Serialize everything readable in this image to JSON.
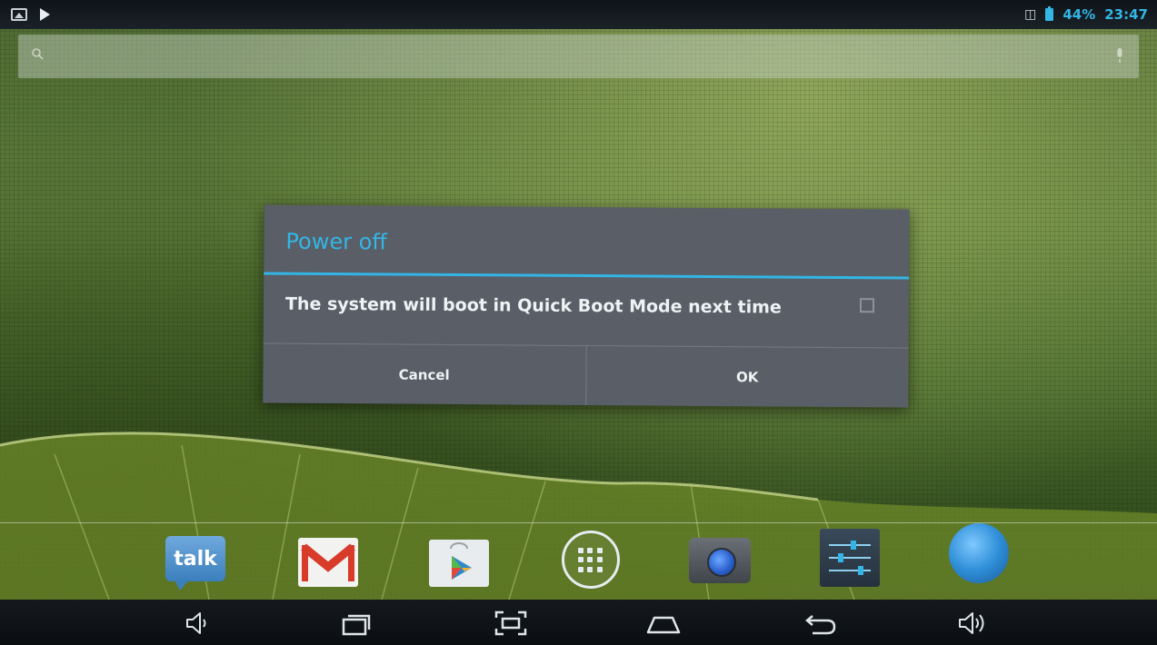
{
  "status_bar": {
    "battery_percent": "44%",
    "time": "23:47",
    "icons": [
      "image-notification-icon",
      "play-notification-icon",
      "usb-icon",
      "battery-icon"
    ],
    "accent_color": "#33b5e5"
  },
  "search_bar": {
    "icons": [
      "search-icon",
      "mic-icon"
    ]
  },
  "dialog": {
    "title": "Power off",
    "message": "The system will boot in Quick Boot Mode next time",
    "checkbox_checked": false,
    "cancel_label": "Cancel",
    "ok_label": "OK"
  },
  "dock": {
    "talk_label": "talk",
    "icons": [
      "talk-app-icon",
      "gmail-app-icon",
      "play-store-app-icon",
      "all-apps-icon",
      "camera-app-icon",
      "settings-app-icon",
      "browser-app-icon"
    ]
  },
  "nav_bar": {
    "icons": [
      "volume-down-icon",
      "recent-apps-icon",
      "screenshot-icon",
      "home-icon",
      "back-icon",
      "volume-up-icon"
    ]
  }
}
